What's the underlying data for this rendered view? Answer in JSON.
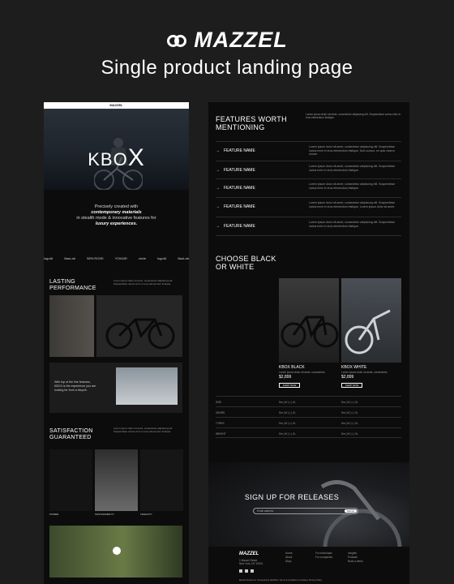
{
  "header": {
    "brand": "MAZZEL",
    "subtitle": "Single product landing page"
  },
  "left_preview": {
    "topbar_logo": "MAZZEL",
    "hero_title": "KBO",
    "hero_title_accent": "X",
    "intro_line1": "Precisely created with",
    "intro_line2": "contemporary materials",
    "intro_line3": "in stealth mode & innovative features for",
    "intro_line4": "luxury experiences.",
    "logos": [
      "logoAI",
      "ǁlaoLab",
      "SEN·ROSE",
      "YOKAIR",
      "circle",
      "logoAI",
      "ǁlaoLab"
    ],
    "lasting": {
      "heading_1": "LASTING",
      "heading_2": "PERFORMANCE",
      "copy": "Lorem ipsum dolor sit amet, consectetur adipiscing elit. Suspendisse varius enim in eros elementum tristique."
    },
    "quote": {
      "line1": "With top of the line features,",
      "line2": "KBOX is the experience you are",
      "line3": "looking for from a bicycle."
    },
    "satisfaction": {
      "heading_1": "SATISFACTION",
      "heading_2": "GUARANTEED",
      "copy": "Lorem ipsum dolor sit amet, consectetur adipiscing elit. Suspendisse varius enim in eros elementum tristique."
    },
    "captions": [
      "POWER",
      "SUSTAINABILITY",
      "TENACITY"
    ]
  },
  "right_preview": {
    "features_heading_1": "FEATURES WORTH",
    "features_heading_2": "MENTIONING",
    "features_intro": "Lorem ipsum dolor sit amet, consectetur adipiscing elit. Suspendisse varius enim in eros elementum tristique.",
    "features": [
      {
        "name": "FEATURE NAME",
        "desc": "Lorem ipsum dolor sit amet, consectetur adipiscing elit. Suspendisse varius enim in eros elementum tristique. Duis cursus, mi quis viverra ornare."
      },
      {
        "name": "FEATURE NAME",
        "desc": "Lorem ipsum dolor sit amet, consectetur adipiscing elit. Suspendisse varius enim in eros elementum tristique."
      },
      {
        "name": "FEATURE NAME",
        "desc": "Lorem ipsum dolor sit amet, consectetur adipiscing elit. Suspendisse varius enim in eros elementum tristique."
      },
      {
        "name": "FEATURE NAME",
        "desc": "Lorem ipsum dolor sit amet, consectetur adipiscing elit. Suspendisse varius enim in eros elementum tristique. Lorem ipsum dolor sit amet."
      },
      {
        "name": "FEATURE NAME",
        "desc": "Lorem ipsum dolor sit amet, consectetur adipiscing elit. Suspendisse varius enim in eros elementum tristique."
      }
    ],
    "choose_heading_1": "CHOOSE BLACK",
    "choose_heading_2": "OR WHITE",
    "products": [
      {
        "name": "KBOX BLACK",
        "copy": "Lorem ipsum dolor sit amet, consectetur.",
        "price": "$2,899",
        "cta": "SHOP NOW"
      },
      {
        "name": "KBOX WHITE",
        "copy": "Lorem ipsum dolor sit amet, consectetur.",
        "price": "$2,899",
        "cta": "SHOP NOW"
      }
    ],
    "specs": [
      {
        "label": "SIZE",
        "a": "Sm | M | L | XL",
        "b": "Sm | M | L | XL"
      },
      {
        "label": "GEARS",
        "a": "Sm | M | L | XL",
        "b": "Sm | M | L | XL"
      },
      {
        "label": "TYRES",
        "a": "Sm | M | L | XL",
        "b": "Sm | M | L | XL"
      },
      {
        "label": "WEIGHT",
        "a": "Sm | M | L | XL",
        "b": "Sm | M | L | XL"
      }
    ],
    "signup_heading": "SIGN UP FOR RELEASES",
    "signup_placeholder": "Email address",
    "signup_button": "Submit",
    "footer": {
      "logo": "MAZZEL",
      "address_1": "1 Mazzel Street",
      "address_2": "New York, NY 10001",
      "col1": [
        "Home",
        "About",
        "Shop"
      ],
      "col2": [
        "For individuals",
        "For companies"
      ],
      "col3": [
        "Insights",
        "Podcast",
        "Book a demo"
      ],
      "copyright": "Mazzel Studio Ltd. | Powered by Webflow | Terms & Conditions | Cookies | Privacy Policy"
    }
  }
}
